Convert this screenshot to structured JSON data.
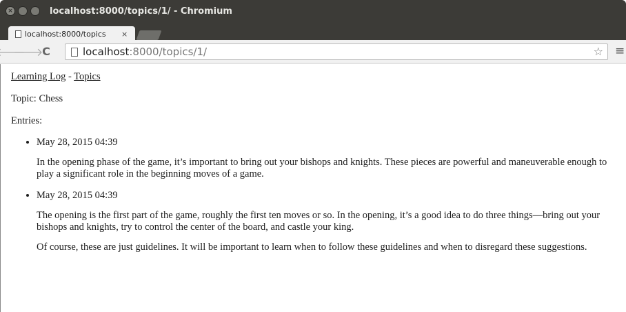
{
  "window": {
    "title": "localhost:8000/topics/1/ - Chromium",
    "buttons": [
      "close",
      "minimize",
      "maximize"
    ]
  },
  "tab": {
    "title": "localhost:8000/topics",
    "close": "×"
  },
  "toolbar": {
    "back_icon": "🡐",
    "forward_icon": "🡒",
    "reload_icon": "C",
    "url_host": "localhost",
    "url_rest": ":8000/topics/1/",
    "star_icon": "☆",
    "menu_icon": "≡"
  },
  "page": {
    "nav": {
      "home_link": "Learning Log",
      "separator": " - ",
      "topics_link": "Topics"
    },
    "topic_line": "Topic: Chess",
    "entries_label": "Entries:",
    "entries": [
      {
        "date": "May 28, 2015 04:39",
        "paragraphs": [
          "In the opening phase of the game, it’s important to bring out your bishops and knights. These pieces are powerful and maneuverable enough to play a significant role in the beginning moves of a game."
        ]
      },
      {
        "date": "May 28, 2015 04:39",
        "paragraphs": [
          "The opening is the first part of the game, roughly the first ten moves or so. In the opening, it’s a good idea to do three things—bring out your bishops and knights, try to control the center of the board, and castle your king.",
          "Of course, these are just guidelines. It will be important to learn when to follow these guidelines and when to disregard these suggestions."
        ]
      }
    ]
  }
}
